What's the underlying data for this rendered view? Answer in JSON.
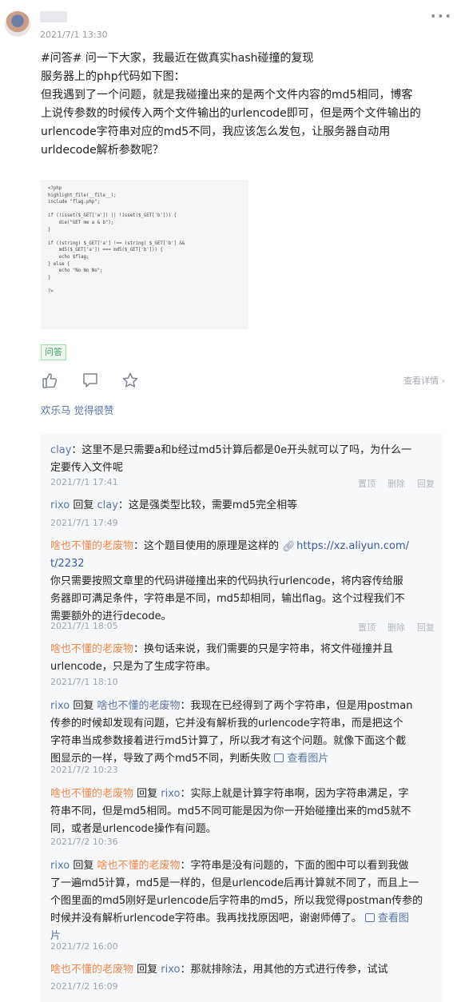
{
  "post": {
    "time": "2021/7/1 13:30",
    "lines": [
      "#问答# 问一下大家，我最近在做真实hash碰撞的复现",
      "服务器上的php代码如下图：",
      "但我遇到了一个问题，就是我碰撞出来的是两个文件内容的md5相同，博客",
      "上说传参数的时候传入两个文件输出的urlencode即可，但是两个文件输出的",
      "urlencode字符串对应的md5不同，我应该怎么发包，让服务器自动用",
      "urldecode解析参数呢？"
    ],
    "code": "<?php\nhighlight_file(__file__);\ninclude \"flag.php\";\n\nif (!isset($_GET['a']) || !isset($_GET['b'])) {\n    die(\"GET me a & b\");\n}\n\nif ((string) $_GET['a'] !== (string) $_GET['b'] &&\n    md5($_GET['a']) === md5($_GET['b'])) {\n    echo $flag;\n} else {\n    echo \"No No No\";\n}\n\n?>",
    "tag": "问答",
    "detail_link": "查看详情 ›",
    "liked_user": "欢乐马",
    "liked_suffix": " 觉得很赞"
  },
  "icons": [
    "thumbs-up-icon",
    "comment-icon",
    "star-icon",
    "more-icon",
    "image-icon",
    "link-icon"
  ],
  "colors": {
    "user_blue": "#5a74a8",
    "user_orange": "#f3884b",
    "tag_green": "#3fa163"
  },
  "comments": [
    {
      "user": "clay",
      "text1": "：这里不是只需要a和b经过md5计算后都是0e开头就可以了吗，为什么一",
      "text2": "定要传入文件呢",
      "time": "2021/7/1 17:41",
      "ops": [
        "置顶",
        "删除",
        "回复"
      ]
    },
    {
      "user": "rixo",
      "reply_word": " 回复 ",
      "reply_to": "clay",
      "text1": "：这是强类型比较，需要md5完全相等",
      "time": "2021/7/1 17:49"
    },
    {
      "user": "啥也不懂的老废物",
      "text1": "：这个题目使用的原理是这样的 ",
      "link1": "https://xz.aliyun.com/",
      "link2": "t/2232",
      "text2": "你只需要按照文章里的代码讲碰撞出来的代码执行urlencode，将内容传给服",
      "text3": "务器即可满足条件，字符串是不同，md5却相同，输出flag。这个过程我们不",
      "text4": "需要额外的进行decode。",
      "time": "2021/7/1 18:05",
      "ops": [
        "置顶",
        "删除",
        "回复"
      ]
    },
    {
      "user": "啥也不懂的老废物",
      "text1": "：换句话来说，我们需要的只是字符串，将文件碰撞并且",
      "text2": "urlencode，只是为了生成字符串。",
      "time": "2021/7/1 18:10"
    },
    {
      "user": "rixo",
      "reply_word": " 回复 ",
      "reply_to": "啥也不懂的老废物",
      "text1": "：我现在已经得到了两个字符串，但是用postman",
      "text2": "传参的时候却发现有问题，它并没有解析我的urlencode字符串，而是把这个",
      "text3": "字符串当成参数接着进行md5计算了，所以我才有这个问题。就像下面这个截",
      "text4": "图显示的一样，导致了两个md5不同，判断失败 ",
      "view_image": "查看图片",
      "time": "2021/7/2 10:23"
    },
    {
      "user": "啥也不懂的老废物",
      "reply_word": " 回复 ",
      "reply_to": "rixo",
      "text1": "：实际上就是计算字符串啊，因为字符串满足，字",
      "text2": "符串不同，但是md5相同。md5不同可能是因为你一开始碰撞出来的md5就不",
      "text3": "同，或者是urlencode操作有问题。",
      "time": "2021/7/2 10:36"
    },
    {
      "user": "rixo",
      "reply_word": " 回复 ",
      "reply_to": "啥也不懂的老废物",
      "text1": "：字符串是没有问题的，下面的图中可以看到我做",
      "text2": "了一遍md5计算，md5是一样的，但是urlencode后再计算就不同了，而且上一",
      "text3": "个图里面的md5刚好是urlencode后字符串的md5，所以我觉得postman传参的",
      "text4": "时候并没有解析urlencode字符串。我再找找原因吧，谢谢师傅了。 ",
      "view_image_1": "查看图",
      "view_image_2": "片",
      "time": "2021/7/2 16:00"
    },
    {
      "user": "啥也不懂的老废物",
      "reply_word": " 回复 ",
      "reply_to": "rixo",
      "text1": "：那就排除法，用其他的方式进行传参，试试",
      "time": "2021/7/2 16:09"
    }
  ]
}
